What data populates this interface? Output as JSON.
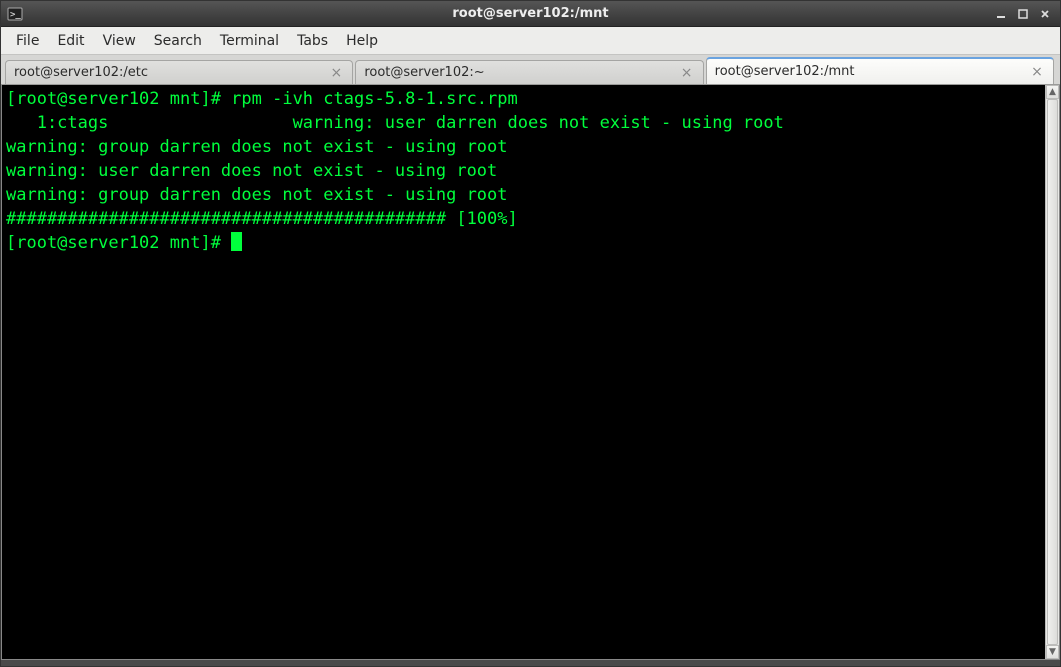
{
  "window": {
    "title": "root@server102:/mnt"
  },
  "menu": {
    "items": [
      "File",
      "Edit",
      "View",
      "Search",
      "Terminal",
      "Tabs",
      "Help"
    ]
  },
  "tabs": [
    {
      "label": "root@server102:/etc",
      "active": false
    },
    {
      "label": "root@server102:~",
      "active": false
    },
    {
      "label": "root@server102:/mnt",
      "active": true
    }
  ],
  "terminal": {
    "lines": [
      "[root@server102 mnt]# rpm -ivh ctags-5.8-1.src.rpm",
      "   1:ctags                  warning: user darren does not exist - using root",
      "warning: group darren does not exist - using root",
      "warning: user darren does not exist - using root",
      "warning: group darren does not exist - using root",
      "########################################### [100%]",
      "[root@server102 mnt]# "
    ]
  }
}
